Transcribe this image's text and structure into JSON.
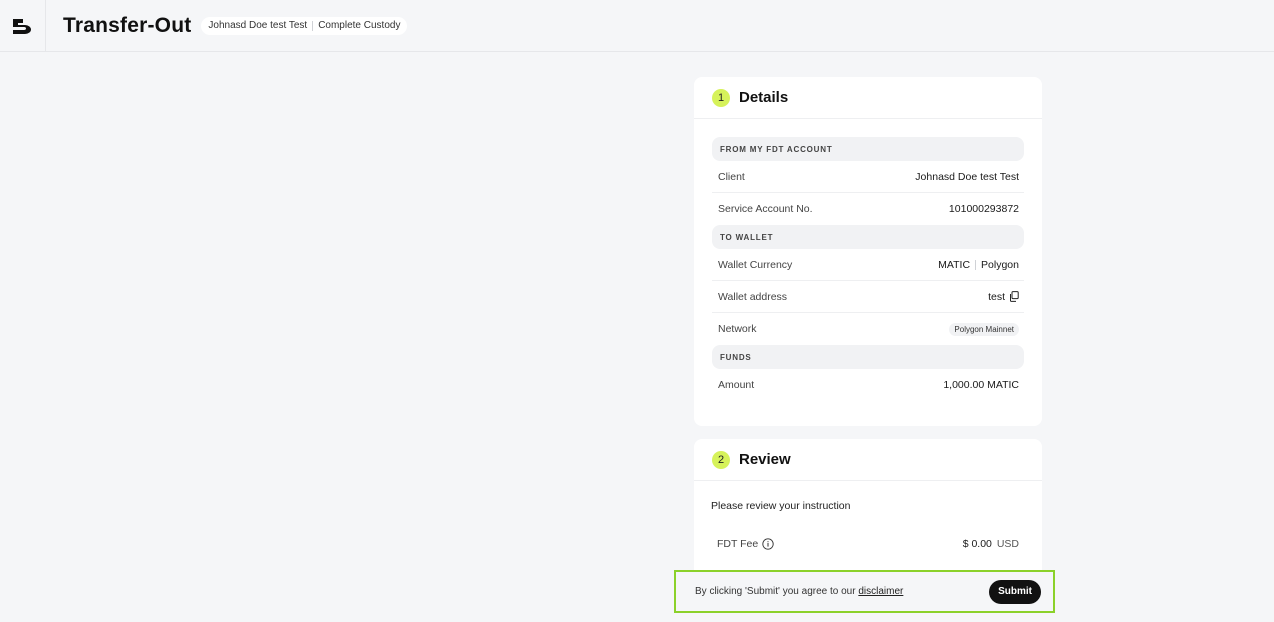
{
  "header": {
    "title": "Transfer-Out",
    "breadcrumb": [
      "Johnasd Doe test Test",
      "Complete Custody"
    ]
  },
  "details": {
    "step": "1",
    "title": "Details",
    "from_section": "FROM MY FDT ACCOUNT",
    "client_label": "Client",
    "client_value": "Johnasd Doe test Test",
    "account_label": "Service Account No.",
    "account_value": "101000293872",
    "to_section": "TO WALLET",
    "currency_label": "Wallet Currency",
    "currency_value": "MATIC",
    "currency_chain": "Polygon",
    "address_label": "Wallet address",
    "address_value": "test",
    "network_label": "Network",
    "network_value": "Polygon Mainnet",
    "funds_section": "FUNDS",
    "amount_label": "Amount",
    "amount_value": "1,000.00 MATIC"
  },
  "review": {
    "step": "2",
    "title": "Review",
    "note": "Please review your instruction",
    "fee_label": "FDT Fee",
    "fee_amount": "$ 0.00",
    "fee_currency": "USD"
  },
  "footer": {
    "disclaimer_prefix": "By clicking 'Submit' you agree to our ",
    "disclaimer_link": "disclaimer",
    "submit_label": "Submit"
  },
  "colors": {
    "accent": "#d6f25a",
    "footer_border": "#8bd12a",
    "submit_bg": "#111111"
  }
}
